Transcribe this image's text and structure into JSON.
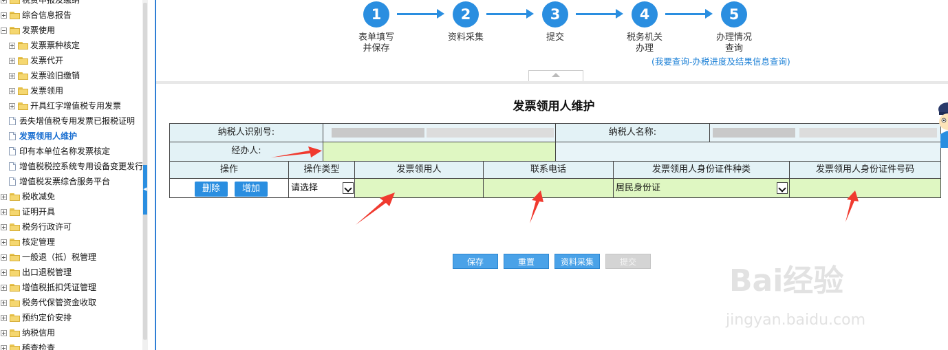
{
  "sidebar": {
    "items": [
      {
        "label": "税费申报及缴纳",
        "type": "folder",
        "indent": 1
      },
      {
        "label": "综合信息报告",
        "type": "folder",
        "indent": 1
      },
      {
        "label": "发票使用",
        "type": "folder",
        "indent": 1,
        "expanded": true
      },
      {
        "label": "发票票种核定",
        "type": "folder",
        "indent": 2
      },
      {
        "label": "发票代开",
        "type": "folder",
        "indent": 2
      },
      {
        "label": "发票验旧缴销",
        "type": "folder",
        "indent": 2
      },
      {
        "label": "发票领用",
        "type": "folder",
        "indent": 2
      },
      {
        "label": "开具红字增值税专用发票",
        "type": "folder",
        "indent": 2
      },
      {
        "label": "丢失增值税专用发票已报税证明",
        "type": "doc",
        "indent": 2
      },
      {
        "label": "发票领用人维护",
        "type": "doc",
        "indent": 2,
        "selected": true
      },
      {
        "label": "印有本单位名称发票核定",
        "type": "doc",
        "indent": 2
      },
      {
        "label": "增值税税控系统专用设备变更发行",
        "type": "doc",
        "indent": 2
      },
      {
        "label": "增值税发票综合服务平台",
        "type": "doc",
        "indent": 2
      },
      {
        "label": "税收减免",
        "type": "folder",
        "indent": 1
      },
      {
        "label": "证明开具",
        "type": "folder",
        "indent": 1
      },
      {
        "label": "税务行政许可",
        "type": "folder",
        "indent": 1
      },
      {
        "label": "核定管理",
        "type": "folder",
        "indent": 1
      },
      {
        "label": "一般退（抵）税管理",
        "type": "folder",
        "indent": 1
      },
      {
        "label": "出口退税管理",
        "type": "folder",
        "indent": 1
      },
      {
        "label": "增值税抵扣凭证管理",
        "type": "folder",
        "indent": 1
      },
      {
        "label": "税务代保管资金收取",
        "type": "folder",
        "indent": 1
      },
      {
        "label": "预约定价安排",
        "type": "folder",
        "indent": 1
      },
      {
        "label": "纳税信用",
        "type": "folder",
        "indent": 1
      },
      {
        "label": "稽查检查",
        "type": "folder",
        "indent": 1
      }
    ]
  },
  "steps": [
    {
      "num": "1",
      "line1": "表单填写",
      "line2": "并保存"
    },
    {
      "num": "2",
      "line1": "资料采集",
      "line2": ""
    },
    {
      "num": "3",
      "line1": "提交",
      "line2": ""
    },
    {
      "num": "4",
      "line1": "税务机关",
      "line2": "办理"
    },
    {
      "num": "5",
      "line1": "办理情况",
      "line2": "查询"
    }
  ],
  "progress_link": "(我要查询-办税进度及结果信息查询)",
  "form": {
    "title": "发票领用人维护",
    "taxpayer_id_label": "纳税人识别号:",
    "taxpayer_name_label": "纳税人名称:",
    "handler_label": "经办人:",
    "columns": [
      "操作",
      "操作类型",
      "发票领用人",
      "联系电话",
      "发票领用人身份证件种类",
      "发票领用人身份证件号码"
    ],
    "row": {
      "delete_label": "删除",
      "add_label": "增加",
      "op_type": "请选择",
      "id_type": "居民身份证"
    }
  },
  "actions": {
    "save": "保存",
    "reset": "重置",
    "collect": "资料采集",
    "submit": "提交"
  },
  "watermark": {
    "brand": "Bai经验",
    "url": "jingyan.baidu.com"
  },
  "colors": {
    "accent": "#2a8ee0",
    "input_bg": "#dff7c2",
    "header_bg": "#e3f2f6",
    "arrow": "#f03a2f"
  }
}
